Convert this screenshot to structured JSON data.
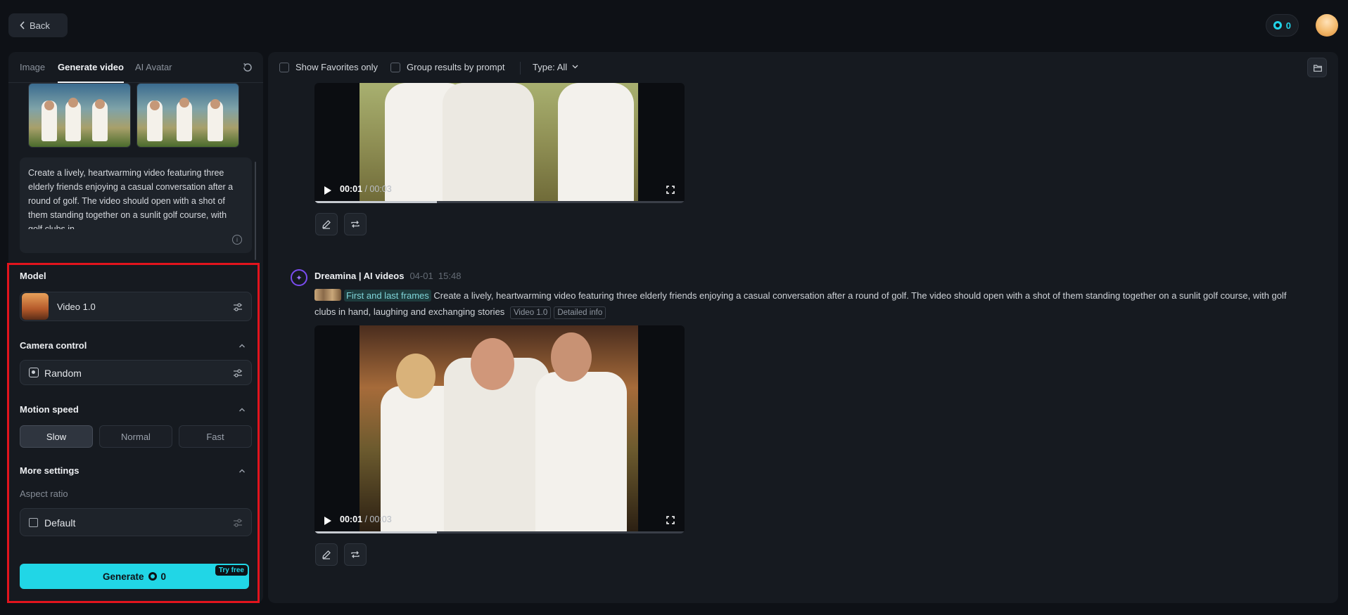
{
  "topbar": {
    "back_label": "Back",
    "credits": "0"
  },
  "left": {
    "tabs": [
      "Image",
      "Generate video",
      "AI Avatar"
    ],
    "prompt": "Create a lively, heartwarming video featuring three elderly friends enjoying a casual conversation after a round of golf. The video should open with a shot of them standing together on a sunlit golf course, with golf clubs in",
    "model_label": "Model",
    "model_value": "Video 1.0",
    "camera_label": "Camera control",
    "camera_value": "Random",
    "motion_label": "Motion speed",
    "speeds": [
      "Slow",
      "Normal",
      "Fast"
    ],
    "speed_selected": "Slow",
    "more_label": "More settings",
    "aspect_label": "Aspect ratio",
    "aspect_value": "Default",
    "generate_label": "Generate",
    "generate_cost": "0",
    "try_free": "Try free"
  },
  "main": {
    "filters": {
      "favorites": "Show Favorites only",
      "group": "Group results by prompt",
      "type": "Type: All"
    },
    "video1": {
      "time": "00:01",
      "duration": "/ 00:03",
      "progress": 0.33
    },
    "result": {
      "author": "Dreamina | AI videos",
      "date": "04-01",
      "time": "15:48",
      "frames_tag": "First and last frames",
      "prompt": "Create a lively, heartwarming video featuring three elderly friends enjoying a casual conversation after a round of golf. The video should open with a shot of them standing together on a sunlit golf course, with golf clubs in hand, laughing and exchanging stories",
      "model_tag": "Video 1.0",
      "info_tag": "Detailed info"
    },
    "video2": {
      "time": "00:01",
      "duration": "/ 00:03",
      "progress": 0.33
    }
  },
  "colors": {
    "accent": "#21d6e6",
    "highlight": "#e2141d",
    "brand": "#7a4cf0"
  },
  "icons": [
    "chevron-left-icon",
    "credit-icon",
    "reset-icon",
    "info-icon",
    "sliders-icon",
    "chevron-up-icon",
    "camera-icon",
    "aspect-icon",
    "folder-icon",
    "play-icon",
    "fullscreen-icon",
    "edit-icon",
    "regenerate-icon",
    "dreamina-logo-icon"
  ]
}
